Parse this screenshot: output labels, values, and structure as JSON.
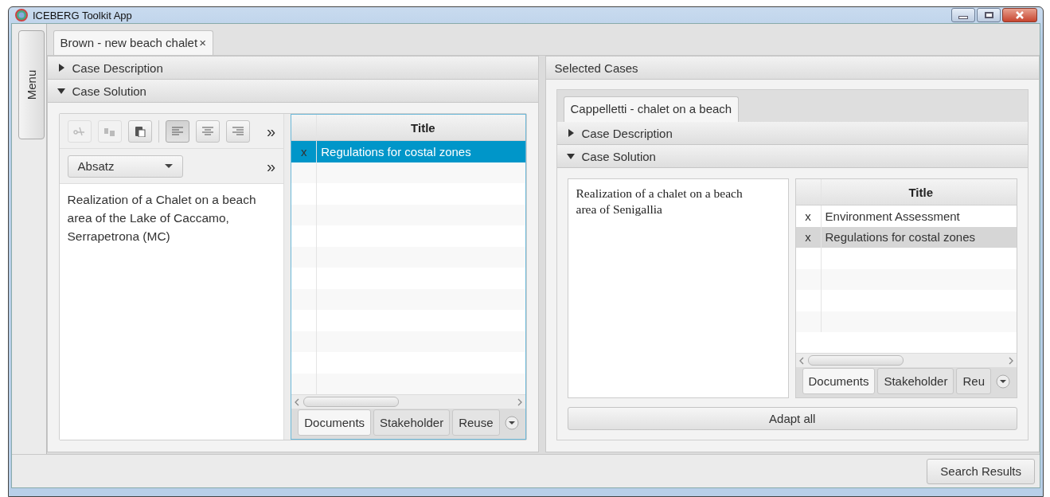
{
  "window": {
    "title": "ICEBERG Toolkit App"
  },
  "menu_button": "Menu",
  "document_tabs": [
    {
      "label": "Brown - new beach chalet",
      "close": "×",
      "selected": true
    }
  ],
  "left_panel": {
    "sections": [
      {
        "title": "Case Description",
        "expanded": false
      },
      {
        "title": "Case Solution",
        "expanded": true
      }
    ],
    "editor": {
      "tools": [
        {
          "kind": "cut",
          "disabled": true,
          "selected": false
        },
        {
          "kind": "copy",
          "disabled": true,
          "selected": false
        },
        {
          "kind": "paste",
          "disabled": false,
          "selected": false
        },
        {
          "kind": "align-left",
          "disabled": false,
          "selected": true
        },
        {
          "kind": "align-center",
          "disabled": false,
          "selected": false
        },
        {
          "kind": "align-right",
          "disabled": false,
          "selected": false
        }
      ],
      "overflow": "»",
      "format": "Absatz",
      "format_overflow": "»",
      "text": "Realization of a Chalet on a beach area of the Lake of Caccamo, Serrapetrona (MC)"
    },
    "table": {
      "columns": [
        "Title"
      ],
      "rows": [
        {
          "mark": "x",
          "title": "Regulations for costal zones",
          "selected": true
        }
      ]
    },
    "bottom_tabs": [
      {
        "label": "Documents",
        "selected": true
      },
      {
        "label": "Stakeholder",
        "selected": false
      },
      {
        "label": "Reuse",
        "selected": false
      }
    ]
  },
  "right_panel": {
    "title": "Selected Cases",
    "case_tabs": [
      {
        "label": "Cappelletti - chalet on a beach",
        "selected": true
      }
    ],
    "sections": [
      {
        "title": "Case Description",
        "expanded": false
      },
      {
        "title": "Case Solution",
        "expanded": true
      }
    ],
    "text": "Realization of a chalet on a beach area of Senigallia",
    "table": {
      "columns": [
        "Title"
      ],
      "rows": [
        {
          "mark": "x",
          "title": "Environment Assessment",
          "selected": false
        },
        {
          "mark": "x",
          "title": "Regulations for costal zones",
          "selected": true
        }
      ]
    },
    "bottom_tabs": [
      {
        "label": "Documents",
        "selected": true
      },
      {
        "label": "Stakeholder",
        "selected": false
      },
      {
        "label": "Reu",
        "selected": false
      }
    ],
    "adapt_button": "Adapt all"
  },
  "footer": {
    "button": "Search Results"
  }
}
